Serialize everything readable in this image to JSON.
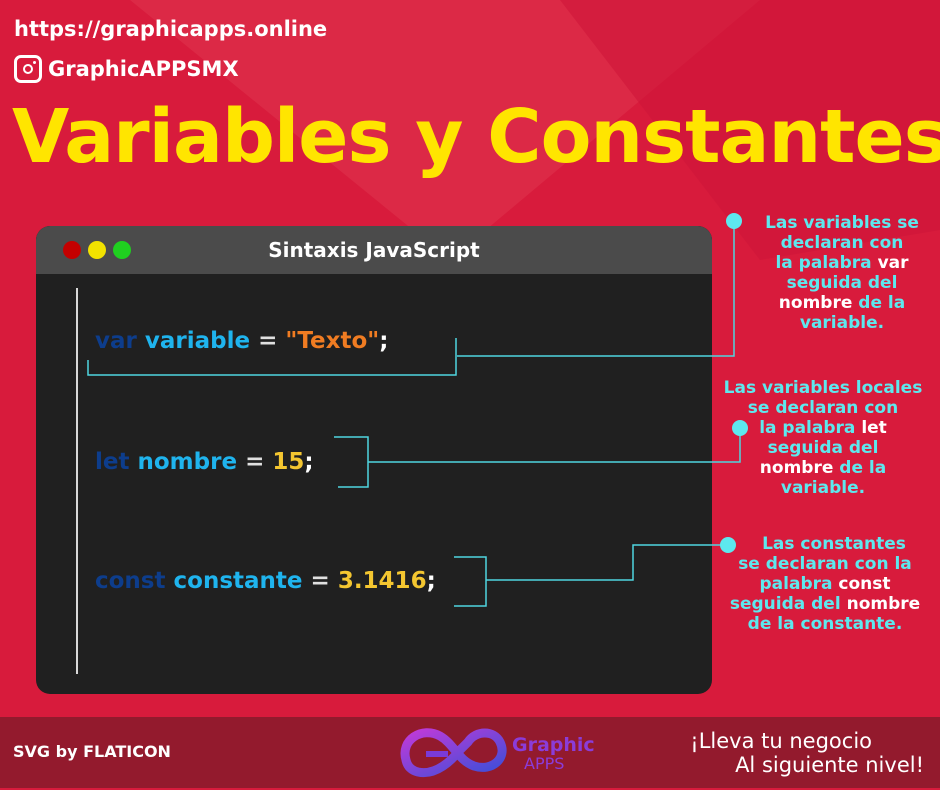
{
  "header": {
    "url": "https://graphicapps.online",
    "instagram_handle": "GraphicAPPSMX",
    "title": "Variables y Constantes"
  },
  "editor": {
    "title": "Sintaxis JavaScript",
    "lines": [
      {
        "keyword": "var",
        "name": "variable",
        "op": "=",
        "value": "\"Texto\"",
        "end": ";"
      },
      {
        "keyword": "let",
        "name": "nombre",
        "op": "=",
        "value": "15",
        "end": ";"
      },
      {
        "keyword": "const",
        "name": "constante",
        "op": "=",
        "value": "3.1416",
        "end": ";"
      }
    ]
  },
  "notes": {
    "var": {
      "l1": "Las variables se",
      "l2": "declaran con",
      "l3a": "la palabra ",
      "l3b": "var",
      "l4": "seguida del",
      "l5a": "nombre",
      "l5b": " de la",
      "l6": "variable."
    },
    "let": {
      "l1": "Las variables locales",
      "l2": "se declaran con",
      "l3a": "la palabra ",
      "l3b": "let",
      "l4": "seguida del",
      "l5a": "nombre",
      "l5b": " de la",
      "l6": "variable."
    },
    "const": {
      "l1": "Las constantes",
      "l2": "se declaran con la",
      "l3a": "palabra ",
      "l3b": "const",
      "l4a": "seguida del ",
      "l4b": "nombre",
      "l5": "de la constante."
    }
  },
  "footer": {
    "credit": "SVG by FLATICON",
    "logo_line1": "Graphic",
    "logo_line2": "APPS",
    "slogan_line1": "¡Lleva tu negocio",
    "slogan_line2": "Al siguiente nivel!"
  },
  "colors": {
    "background": "#d81b3c",
    "title": "#ffe500",
    "accent": "#5de8ee",
    "editor": "#202020",
    "footer": "#931a2d"
  }
}
